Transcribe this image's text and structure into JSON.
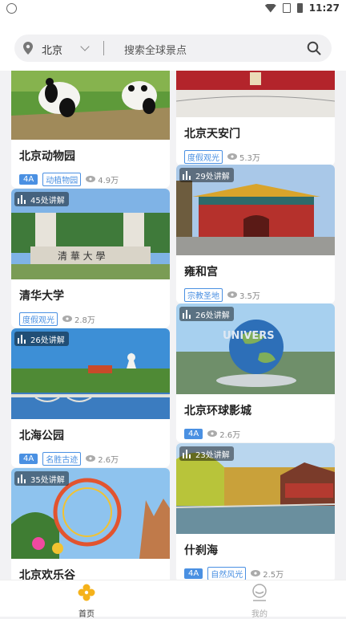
{
  "status_bar": {
    "time": "11:27"
  },
  "search": {
    "city": "北京",
    "placeholder": "搜索全球景点"
  },
  "colors": {
    "accent": "#4a90e2",
    "brand": "#f5b21a",
    "tab_inactive": "#aaaaaa"
  },
  "cards": [
    {
      "title": "北京动物园",
      "grade": "4A",
      "category": "动植物园",
      "views": "4.9万",
      "badge": ""
    },
    {
      "title": "北京天安门",
      "grade": "",
      "category": "度假观光",
      "views": "5.3万",
      "badge": ""
    },
    {
      "title": "清华大学",
      "grade": "",
      "category": "度假观光",
      "views": "2.8万",
      "badge": "45处讲解"
    },
    {
      "title": "雍和宫",
      "grade": "",
      "category": "宗教圣地",
      "views": "3.5万",
      "badge": "29处讲解"
    },
    {
      "title": "北海公园",
      "grade": "4A",
      "category": "名胜古迹",
      "views": "2.6万",
      "badge": "26处讲解"
    },
    {
      "title": "北京环球影城",
      "grade": "4A",
      "category": "",
      "views": "2.6万",
      "badge": "26处讲解"
    },
    {
      "title": "北京欢乐谷",
      "grade": "",
      "category": "",
      "views": "",
      "badge": "35处讲解"
    },
    {
      "title": "什刹海",
      "grade": "4A",
      "category": "自然风光",
      "views": "2.5万",
      "badge": "23处讲解"
    }
  ],
  "tabs": [
    {
      "label": "首页",
      "active": true,
      "icon": "home-flower-icon"
    },
    {
      "label": "我的",
      "active": false,
      "icon": "profile-icon"
    }
  ]
}
